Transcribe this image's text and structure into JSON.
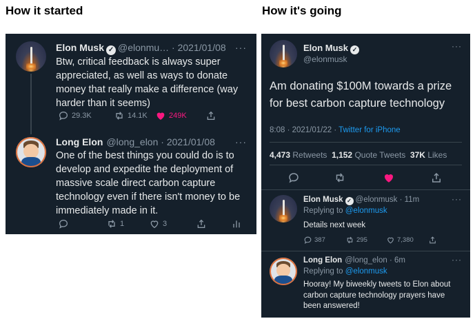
{
  "headings": {
    "left": "How it started",
    "right": "How it's going"
  },
  "left": {
    "tweet1": {
      "name": "Elon Musk",
      "handle": "@elonmu…",
      "date": "2021/01/08",
      "text": "Btw, critical feedback is always super appreciated, as well as ways to donate money that really make a difference (way harder than it seems)",
      "replies": "29.3K",
      "retweets": "14.1K",
      "likes": "249K"
    },
    "tweet2": {
      "name": "Long Elon",
      "handle": "@long_elon",
      "date": "2021/01/08",
      "text": "One of the best things you could do is to develop and expedite the deployment of massive scale direct carbon capture technology even if there isn't money to be immediately made in it.",
      "replies": "",
      "retweets": "1",
      "likes": "3"
    }
  },
  "right": {
    "main": {
      "name": "Elon Musk",
      "handle": "@elonmusk",
      "text": "Am donating $100M towards a prize for best carbon capture technology",
      "time": "8:08 · 2021/01/22 · ",
      "source": "Twitter for iPhone",
      "retweets_count": "4,473",
      "retweets_label": "Retweets",
      "quotes_count": "1,152",
      "quotes_label": "Quote Tweets",
      "likes_count": "37K",
      "likes_label": "Likes"
    },
    "reply1": {
      "name": "Elon Musk",
      "handle": "@elonmusk",
      "age": "11m",
      "replying_prefix": "Replying to",
      "replying_to": "@elonmusk",
      "text": "Details next week",
      "replies": "387",
      "retweets": "295",
      "likes": "7,380"
    },
    "reply2": {
      "name": "Long Elon",
      "handle": "@long_elon",
      "age": "6m",
      "replying_prefix": "Replying to",
      "replying_to": "@elonmusk",
      "text": "Hooray! My biweekly tweets to Elon about carbon capture technology prayers have been answered!"
    }
  },
  "icons": {
    "reply": "reply-icon",
    "retweet": "retweet-icon",
    "like": "heart-icon",
    "share": "share-icon",
    "analytics": "analytics-icon",
    "verified": "verified-badge-icon",
    "more": "more-icon"
  },
  "colors": {
    "background": "#15202b",
    "text": "#e7e9ea",
    "muted": "#8b98a5",
    "like": "#f91880",
    "link": "#1d9bf0"
  }
}
